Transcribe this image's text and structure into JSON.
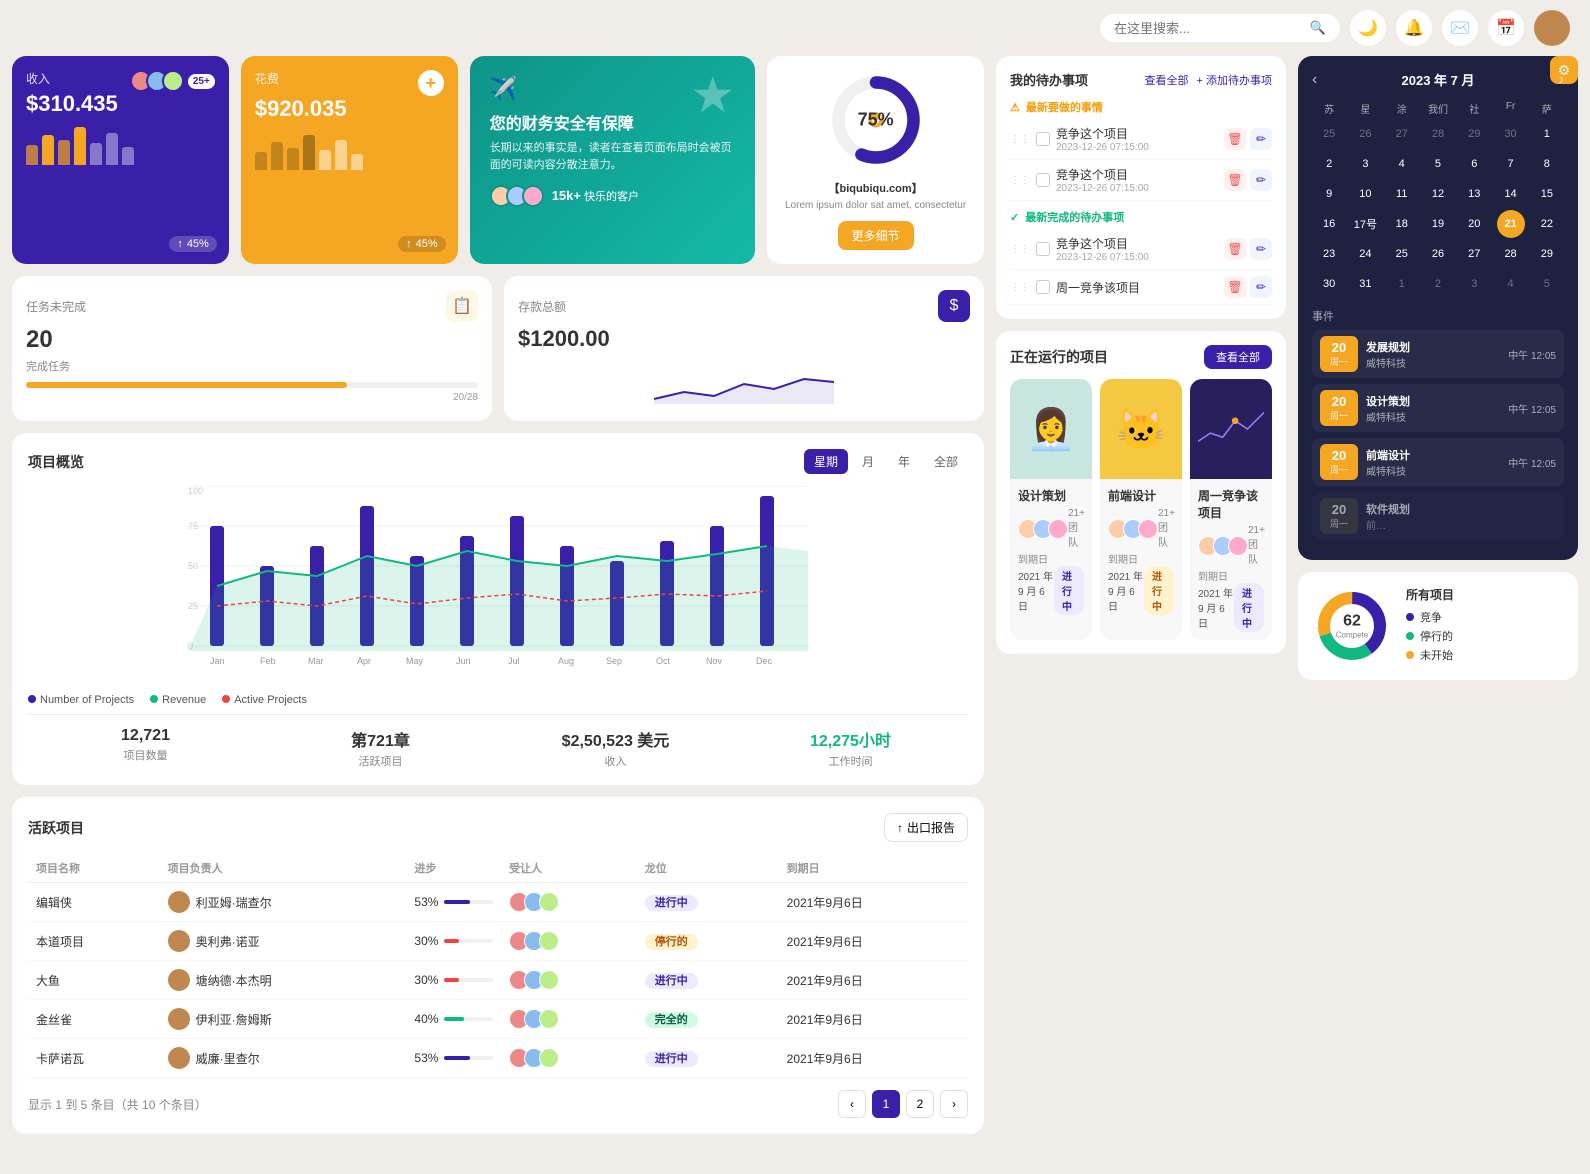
{
  "topbar": {
    "search_placeholder": "在这里搜索...",
    "icons": [
      "moon",
      "bell",
      "mail",
      "calendar",
      "user-avatar"
    ]
  },
  "revenue_card": {
    "title": "收入",
    "amount": "$310.435",
    "badge": "25+",
    "pct": "45%",
    "bars": [
      30,
      50,
      45,
      65,
      40,
      55,
      35
    ],
    "bar_colors": [
      "#f5a623",
      "#f5a623",
      "#f5a623",
      "#f5a623",
      "#f5a623",
      "#f5a623",
      "#f5a623"
    ]
  },
  "expense_card": {
    "title": "花费",
    "amount": "$920.035",
    "pct": "45%"
  },
  "promo_card": {
    "title": "您的财务安全有保障",
    "desc": "长期以来的事实是，读者在查看页面布局时会被页面的可读内容分散注意力。",
    "customers_count": "15k+",
    "customers_label": "快乐的客户"
  },
  "donut_card": {
    "pct": "75%",
    "url": "【biqubiqu.com】",
    "desc": "Lorem ipsum dolor sat amet, consectetur",
    "btn": "更多细节"
  },
  "tasks_card": {
    "title": "任务未完成",
    "count": "20",
    "label": "完成任务",
    "progress_text": "20/28",
    "progress_pct": 71
  },
  "savings_card": {
    "title": "存款总额",
    "amount": "$1200.00"
  },
  "project_overview": {
    "title": "项目概览",
    "tabs": [
      "星期",
      "月",
      "年",
      "全部"
    ],
    "active_tab": "星期",
    "legend": [
      {
        "label": "Number of Projects",
        "color": "#3a1fa8"
      },
      {
        "label": "Revenue",
        "color": "#10b981"
      },
      {
        "label": "Active Projects",
        "color": "#ef4444"
      }
    ],
    "stats": [
      {
        "value": "12,721",
        "label": "项目数量"
      },
      {
        "value": "第721章",
        "label": "活跃项目"
      },
      {
        "value": "$2,50,523 美元",
        "label": "收入"
      },
      {
        "value": "12,275小时",
        "label": "工作时间",
        "color": "green"
      }
    ],
    "months": [
      "Jan",
      "Feb",
      "Mar",
      "Apr",
      "May",
      "Jun",
      "Jul",
      "Aug",
      "Sep",
      "Oct",
      "Nov",
      "Dec"
    ]
  },
  "active_projects": {
    "title": "活跃项目",
    "export_btn": "出口报告",
    "columns": [
      "项目名称",
      "项目负责人",
      "进步",
      "受让人",
      "龙位",
      "到期日"
    ],
    "rows": [
      {
        "name": "编辑侠",
        "owner": "利亚姆·瑞查尔",
        "progress": 53,
        "prog_color": "#3a1fa8",
        "status": "进行中",
        "status_type": "progress",
        "date": "2021年9月6日"
      },
      {
        "name": "本道项目",
        "owner": "奥利弗·诺亚",
        "progress": 30,
        "prog_color": "#ef4444",
        "status": "停行的",
        "status_type": "hold",
        "date": "2021年9月6日"
      },
      {
        "name": "大鱼",
        "owner": "塘纳德·本杰明",
        "progress": 30,
        "prog_color": "#ef4444",
        "status": "进行中",
        "status_type": "progress",
        "date": "2021年9月6日"
      },
      {
        "name": "金丝雀",
        "owner": "伊利亚·詹姆斯",
        "progress": 40,
        "prog_color": "#10b981",
        "status": "完全的",
        "status_type": "complete",
        "date": "2021年9月6日"
      },
      {
        "name": "卡萨诺瓦",
        "owner": "威廉·里查尔",
        "progress": 53,
        "prog_color": "#3a1fa8",
        "status": "进行中",
        "status_type": "progress",
        "date": "2021年9月6日"
      }
    ],
    "pagination_info": "显示 1 到 5 条目（共 10 个条目）",
    "current_page": 1,
    "total_pages": 2
  },
  "todo": {
    "title": "我的待办事项",
    "view_all": "查看全部",
    "add": "+ 添加待办事项",
    "urgent_label": "最新要做的事情",
    "done_label": "最新完成的待办事项",
    "items_urgent": [
      {
        "text": "竞争这个项目",
        "date": "2023-12-26 07:15:00"
      },
      {
        "text": "竞争这个项目",
        "date": "2023-12-26 07:15:00"
      }
    ],
    "items_done": [
      {
        "text": "竞争这个项目",
        "date": "2023-12-26 07:15:00"
      }
    ],
    "item_extra": "周一竞争该项目"
  },
  "running_projects": {
    "title": "正在运行的项目",
    "view_all": "查看全部",
    "projects": [
      {
        "name": "设计策划",
        "team": "21+ 团队",
        "deadline": "2021 年 9 月 6 日",
        "status": "进行中",
        "status_type": "progress",
        "bg": "#c8e6e0",
        "emoji": "👩‍💼"
      },
      {
        "name": "前端设计",
        "team": "21+ 团队",
        "deadline": "2021 年 9 月 6 日",
        "status": "进行中",
        "status_type": "hold",
        "bg": "#f5c842",
        "emoji": "🐱"
      },
      {
        "name": "周一竞争该项目",
        "team": "21+ 团队",
        "deadline": "2021 年 9 月 6 日",
        "status": "进行中",
        "status_type": "progress",
        "bg": "#2a1f5e",
        "emoji": "📈"
      }
    ]
  },
  "calendar": {
    "title": "2023 年 7 月",
    "day_headers": [
      "苏",
      "星",
      "涂",
      "我们",
      "社",
      "Fr",
      "萨"
    ],
    "prev_days": [
      25,
      26,
      27,
      28,
      29,
      30,
      1
    ],
    "week1": [
      2,
      3,
      4,
      5,
      6,
      7,
      8
    ],
    "week2": [
      9,
      10,
      11,
      12,
      13,
      14,
      15
    ],
    "week3": [
      16,
      "17号",
      18,
      19,
      20,
      "21",
      22
    ],
    "week4": [
      23,
      24,
      25,
      26,
      27,
      28,
      29
    ],
    "week5": [
      30,
      31,
      1,
      2,
      3,
      4,
      5
    ],
    "today": 21,
    "events_title": "事件",
    "events": [
      {
        "date_num": "20",
        "date_day": "周一",
        "name": "发展规划",
        "company": "威特科技",
        "time": "中午 12:05"
      },
      {
        "date_num": "20",
        "date_day": "周一",
        "name": "设计策划",
        "company": "威特科技",
        "time": "中午 12:05"
      },
      {
        "date_num": "20",
        "date_day": "周一",
        "name": "前端设计",
        "company": "威特科技",
        "time": "中午 12:05"
      },
      {
        "date_num": "20",
        "date_day": "周一",
        "name": "软件规划",
        "company": "前…",
        "time": ""
      }
    ]
  },
  "all_projects": {
    "title": "所有项目",
    "center_num": "62",
    "center_label": "Compete",
    "legend": [
      {
        "label": "竞争",
        "color": "#3a1fa8"
      },
      {
        "label": "停行的",
        "color": "#10b981"
      },
      {
        "label": "未开始",
        "color": "#f5a623"
      }
    ]
  }
}
